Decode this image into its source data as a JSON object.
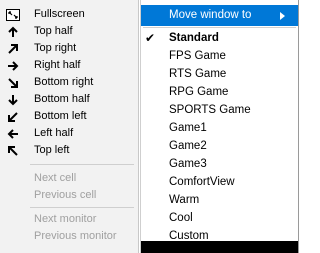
{
  "left_menu": {
    "items": [
      {
        "label": "Fullscreen",
        "icon": "fullscreen-icon"
      },
      {
        "label": "Top half",
        "icon": "arrow-up-icon"
      },
      {
        "label": "Top right",
        "icon": "arrow-up-right-icon"
      },
      {
        "label": "Right half",
        "icon": "arrow-right-icon"
      },
      {
        "label": "Bottom right",
        "icon": "arrow-down-right-icon"
      },
      {
        "label": "Bottom half",
        "icon": "arrow-down-icon"
      },
      {
        "label": "Bottom left",
        "icon": "arrow-down-left-icon"
      },
      {
        "label": "Left half",
        "icon": "arrow-left-icon"
      },
      {
        "label": "Top left",
        "icon": "arrow-up-left-icon"
      }
    ],
    "cells": [
      {
        "label": "Next cell",
        "enabled": false
      },
      {
        "label": "Previous cell",
        "enabled": false
      }
    ],
    "monitors": [
      {
        "label": "Next monitor",
        "enabled": false
      },
      {
        "label": "Previous monitor",
        "enabled": false
      }
    ]
  },
  "right_menu": {
    "move_window_label": "Move window to",
    "checked_item": "Standard",
    "items": [
      "Standard",
      "FPS Game",
      "RTS Game",
      "RPG Game",
      "SPORTS Game",
      "Game1",
      "Game2",
      "Game3",
      "ComfortView",
      "Warm",
      "Cool",
      "Custom"
    ]
  },
  "colors": {
    "highlight": "#0078d7",
    "menu_bg": "#f2f2f2",
    "disabled_text": "#a0a0a0"
  }
}
